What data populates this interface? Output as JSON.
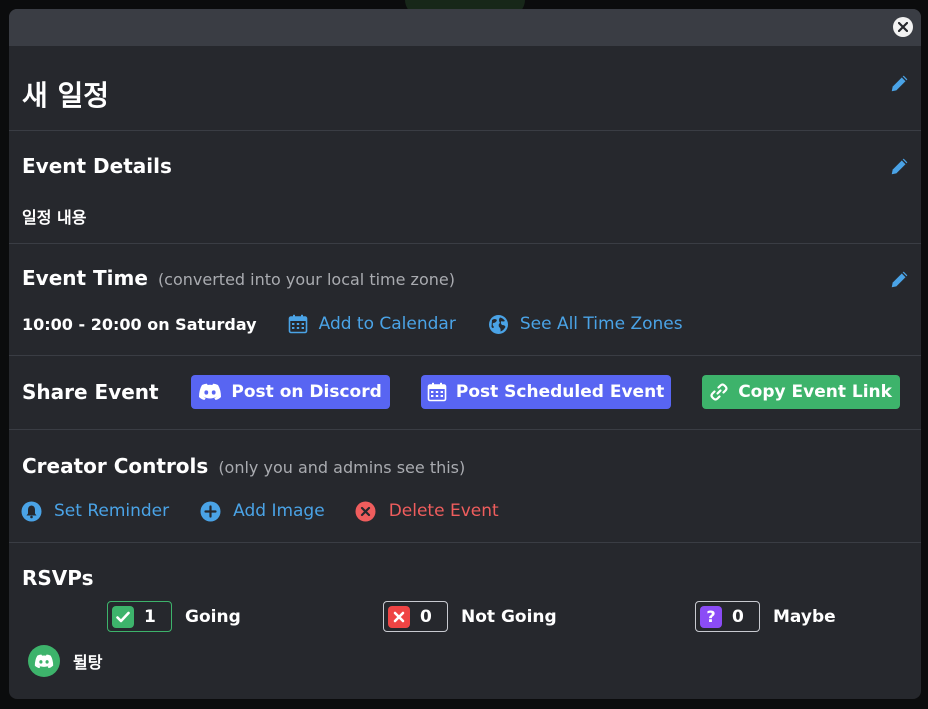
{
  "title": "새 일정",
  "details": {
    "heading": "Event Details",
    "text": "일정 내용"
  },
  "time": {
    "heading": "Event Time",
    "note": "(converted into your local time zone)",
    "value": "10:00 - 20:00 on Saturday",
    "add_calendar": "Add to Calendar",
    "see_timezones": "See All Time Zones"
  },
  "share": {
    "heading": "Share Event",
    "post_discord": "Post on Discord",
    "post_scheduled": "Post Scheduled Event",
    "copy_link": "Copy Event Link"
  },
  "creator": {
    "heading": "Creator Controls",
    "note": "(only you and admins see this)",
    "set_reminder": "Set Reminder",
    "add_image": "Add Image",
    "delete_event": "Delete Event"
  },
  "rsvps": {
    "heading": "RSVPs",
    "going": {
      "count": "1",
      "label": "Going"
    },
    "not_going": {
      "count": "0",
      "label": "Not Going"
    },
    "maybe": {
      "count": "0",
      "label": "Maybe"
    },
    "attendees": [
      {
        "name": "뒬탕"
      }
    ]
  },
  "colors": {
    "link_blue": "#4aa3e6",
    "discord_blurple": "#5865f2",
    "success_green": "#3db36b",
    "danger_red": "#ef5d5d",
    "maybe_purple": "#8b4cf6"
  },
  "icons": {
    "close": "close-icon",
    "edit": "pencil-icon",
    "calendar": "calendar-icon",
    "globe": "globe-icon",
    "discord": "discord-icon",
    "link": "link-icon",
    "bell": "bell-icon",
    "plus": "plus-circle-icon",
    "delete": "x-circle-icon",
    "check": "check-icon",
    "cross": "x-icon",
    "question": "question-icon"
  }
}
